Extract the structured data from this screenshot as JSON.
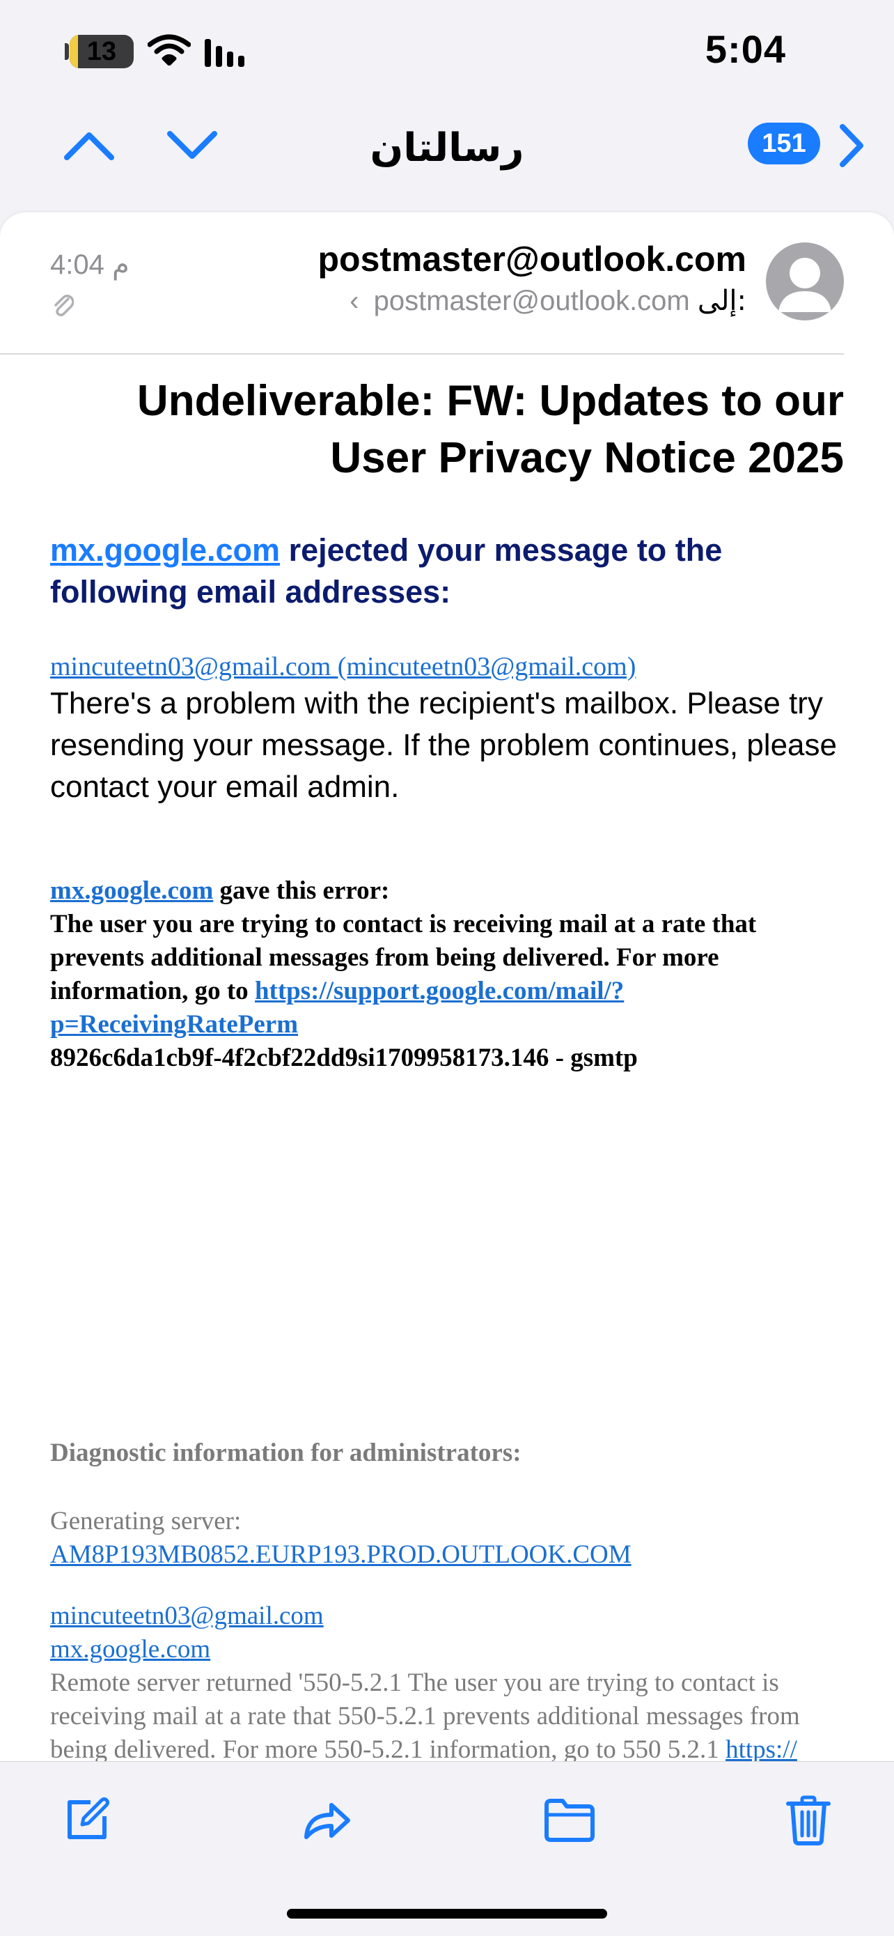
{
  "status_bar": {
    "battery_level": "13",
    "battery_fraction": 0.13,
    "time": "5:04"
  },
  "nav": {
    "title": "رسالتان",
    "unread_count": "151"
  },
  "header": {
    "sender": "postmaster@outlook.com",
    "to_label": "إلى:",
    "to_value": "postmaster@outlook.com",
    "time": "4:04 م"
  },
  "subject": "Undeliverable: FW: Updates to our User Privacy Notice 2025",
  "body": {
    "rejected_link": "mx.google.com",
    "rejected_text": " rejected your message to the following email addresses:",
    "recipient": "mincuteetn03@gmail.com (mincuteetn03@gmail.com)",
    "problem_text": "There's a problem with the recipient's mailbox. Please try resending your message. If the problem continues, please contact your email admin.",
    "error_link": "mx.google.com",
    "error_intro": " gave this error:",
    "error_text": "The user you are trying to contact is receiving mail at a rate that prevents additional messages from being delivered. For more information, go to ",
    "error_url": "https://support.google.com/mail/?p=ReceivingRatePerm",
    "error_code": "8926c6da1cb9f-4f2cbf22dd9si1709958173.146 - gsmtp"
  },
  "diagnostics": {
    "heading": "Diagnostic information for administrators:",
    "generating_label": "Generating server:",
    "generating_server": "AM8P193MB0852.EURP193.PROD.OUTLOOK.COM",
    "recipient": "mincuteetn03@gmail.com",
    "remote_host": "mx.google.com",
    "remote_text": "Remote server returned '550-5.2.1 The user you are trying to contact is receiving mail at a rate that 550-5.2.1 prevents additional messages from being delivered. For more 550-5.2.1 information, go to 550 5.2.1 ",
    "remote_link": "https://"
  },
  "toolbar": {
    "icons": [
      "compose-icon",
      "reply-forward-icon",
      "move-to-folder-icon",
      "trash-icon"
    ]
  },
  "colors": {
    "accent": "#1a7cff",
    "link": "#1a6fd1",
    "dark_blue_text": "#0b1b6e",
    "battery": "#f2cd44",
    "secondary_text": "#8e8e93"
  }
}
